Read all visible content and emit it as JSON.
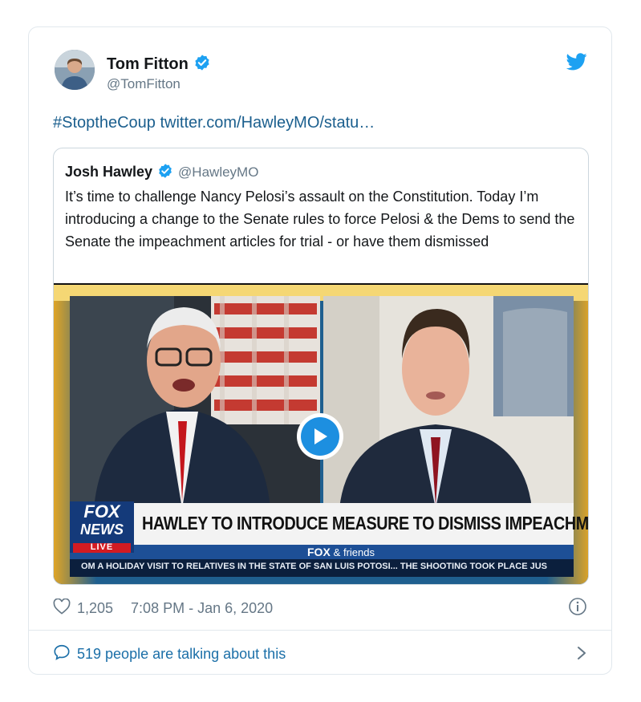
{
  "tweet": {
    "author_name": "Tom Fitton",
    "author_handle": "@TomFitton",
    "hashtag": "#StoptheCoup",
    "link_text": "twitter.com/HawleyMO/statu…",
    "likes": "1,205",
    "timestamp": "7:08 PM - Jan 6, 2020",
    "talking_text": "519 people are talking about this"
  },
  "quoted": {
    "author_name": "Josh Hawley",
    "author_handle": "@HawleyMO",
    "text": "It’s time to challenge Nancy Pelosi’s assault on the Constitution. Today I’m introducing a change to the Senate rules to force Pelosi & the Dems to send the Senate the impeachment articles for trial - or have them dismissed"
  },
  "video": {
    "headline": "HAWLEY TO INTRODUCE MEASURE TO DISMISS IMPEACHMENT",
    "network_top": "FOX",
    "network_bottom": "NEWS",
    "live_label": "LIVE",
    "show_logo": "FOX",
    "show_logo_suffix": "& friends",
    "ticker": "OM A HOLIDAY VISIT TO RELATIVES IN THE STATE OF SAN LUIS POTOSI...   THE SHOOTING TOOK PLACE JUS"
  },
  "colors": {
    "twitter_blue": "#1da1f2",
    "link_blue": "#1b5f8e",
    "muted": "#657786"
  },
  "icons": [
    "verified-badge-icon",
    "twitter-bird-icon",
    "play-icon",
    "heart-icon",
    "info-icon",
    "speech-bubble-icon",
    "chevron-right-icon"
  ]
}
